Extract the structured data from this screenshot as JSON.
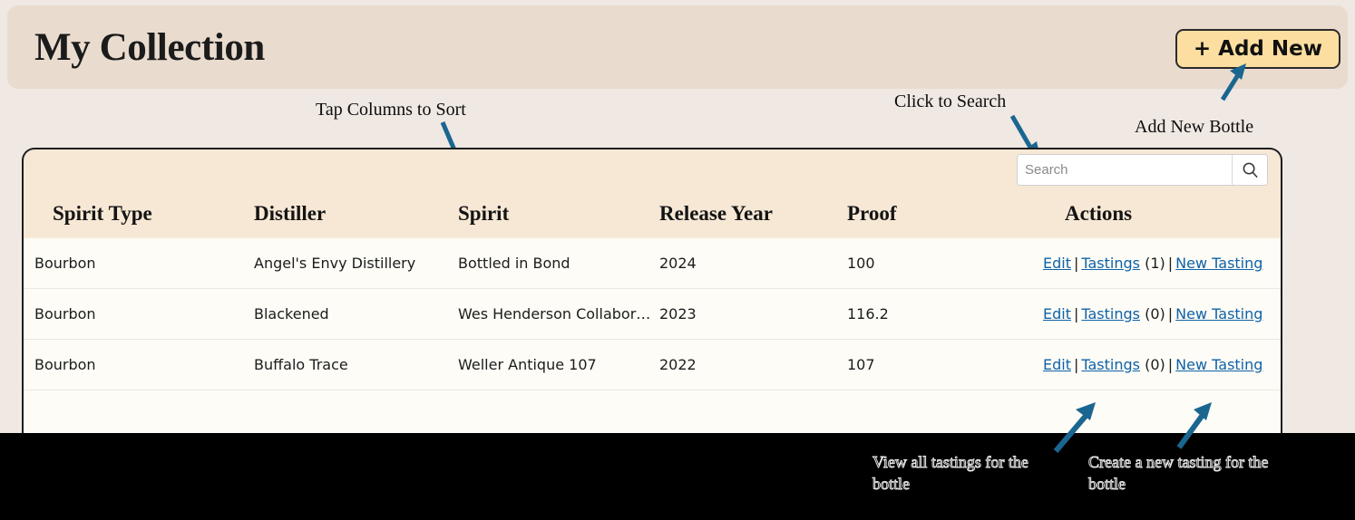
{
  "header": {
    "title": "My Collection",
    "add_new_label": "+ Add New"
  },
  "annotations": {
    "sort": "Tap Columns to Sort",
    "search": "Click to Search",
    "add_new": "Add New Bottle",
    "tastings": "View all tastings for the bottle",
    "new_tasting": "Create a new tasting for the bottle"
  },
  "search": {
    "placeholder": "Search",
    "value": "",
    "icon": "search-icon"
  },
  "table": {
    "columns": [
      "Spirit Type",
      "Distiller",
      "Spirit",
      "Release Year",
      "Proof",
      "Actions"
    ],
    "rows": [
      {
        "spirit_type": "Bourbon",
        "distiller": "Angel's Envy Distillery",
        "spirit": "Bottled in Bond",
        "release_year": "2024",
        "proof": "100",
        "actions": {
          "edit": "Edit",
          "tastings": "Tastings",
          "count": "(1)",
          "new_tasting": "New Tasting",
          "separator": "|"
        }
      },
      {
        "spirit_type": "Bourbon",
        "distiller": "Blackened",
        "spirit": "Wes Henderson Collabor…",
        "release_year": "2023",
        "proof": "116.2",
        "actions": {
          "edit": "Edit",
          "tastings": "Tastings",
          "count": "(0)",
          "new_tasting": "New Tasting",
          "separator": "|"
        }
      },
      {
        "spirit_type": "Bourbon",
        "distiller": "Buffalo Trace",
        "spirit": "Weller Antique 107",
        "release_year": "2022",
        "proof": "107",
        "actions": {
          "edit": "Edit",
          "tastings": "Tastings",
          "count": "(0)",
          "new_tasting": "New Tasting",
          "separator": "|"
        }
      }
    ]
  },
  "colors": {
    "page_background": "#EFE8E3",
    "header_band": "#E9DCCF",
    "table_header": "#F7E8D5",
    "row_background": "#FDFCF6",
    "accent_button": "#FCDFA0",
    "link": "#0F62A8",
    "arrow": "#1A6691",
    "overlay_background": "#000000"
  }
}
